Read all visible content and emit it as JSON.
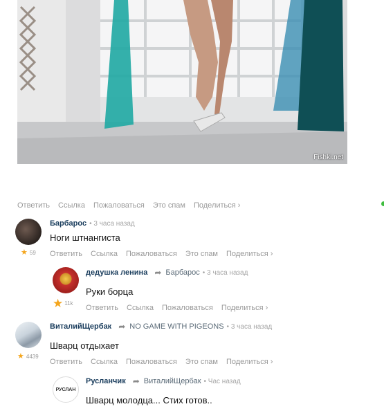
{
  "photo": {
    "watermark": "Fishki.net"
  },
  "top_actions": [
    "Ответить",
    "Ссылка",
    "Пожаловаться",
    "Это спам",
    "Поделиться ›"
  ],
  "comments": [
    {
      "author": "Барбарос",
      "time": "• 3 часа назад",
      "text": "Ноги штнангиста",
      "rating": "59",
      "actions": [
        "Ответить",
        "Ссылка",
        "Пожаловаться",
        "Это спам",
        "Поделиться ›"
      ]
    },
    {
      "author": "дедушка ленина",
      "reply_to": "Барбарос",
      "time": "• 3 часа назад",
      "text": "Руки борца",
      "rating": "11k",
      "actions": [
        "Ответить",
        "Ссылка",
        "Пожаловаться",
        "Поделиться ›"
      ]
    },
    {
      "author": "ВиталийЩербак",
      "reply_to": "NO GAME WITH PIGEONS",
      "time": "• 3 часа назад",
      "text": "Шварц отдыхает",
      "rating": "4439",
      "actions": [
        "Ответить",
        "Ссылка",
        "Пожаловаться",
        "Это спам",
        "Поделиться ›"
      ]
    },
    {
      "author": "Русланчик",
      "reply_to": "ВиталийЩербак",
      "time": "• Час назад",
      "text": "Шварц молодца... Стих готов..",
      "avatar_label": "РУСЛАН"
    }
  ],
  "colors": {
    "author": "#1a3d5d",
    "muted": "#999999",
    "star": "#f4a51c",
    "status_dot": "#3fbd3f"
  }
}
